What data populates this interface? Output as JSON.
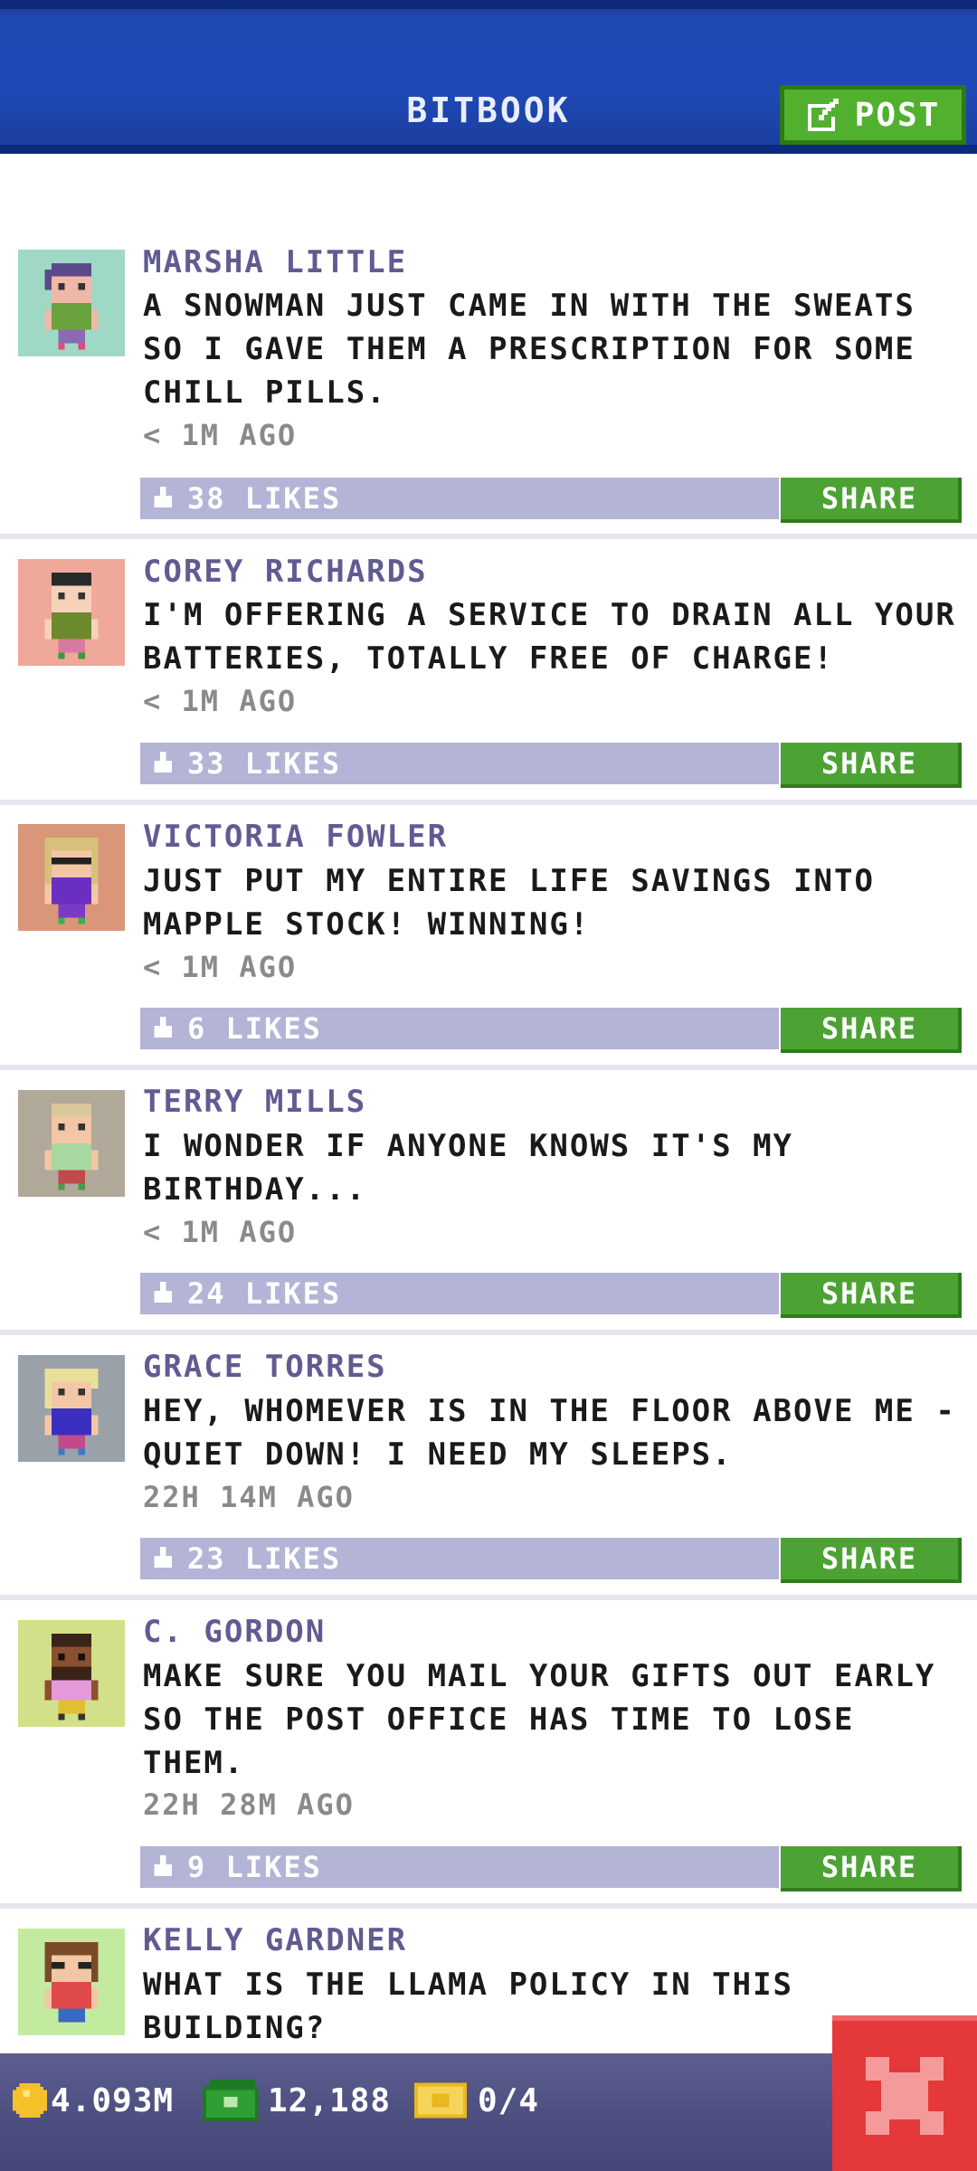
{
  "header": {
    "title": "BITBOOK",
    "post_label": "POST"
  },
  "posts": [
    {
      "author": "MARSHA LITTLE",
      "message": "A SNOWMAN JUST CAME IN WITH THE SWEATS SO I GAVE THEM A PRESCRIPTION FOR SOME CHILL PILLS.",
      "time": "< 1M AGO",
      "likes": "38 LIKES",
      "share_label": "SHARE",
      "avatar_bg": "#9fd9c6"
    },
    {
      "author": "COREY RICHARDS",
      "message": "I'M OFFERING A SERVICE TO DRAIN ALL YOUR BATTERIES, TOTALLY FREE OF CHARGE!",
      "time": "< 1M AGO",
      "likes": "33 LIKES",
      "share_label": "SHARE",
      "avatar_bg": "#f0a89a"
    },
    {
      "author": "VICTORIA FOWLER",
      "message": "JUST PUT MY ENTIRE LIFE SAVINGS INTO MAPPLE STOCK! WINNING!",
      "time": "< 1M AGO",
      "likes": "6 LIKES",
      "share_label": "SHARE",
      "avatar_bg": "#d99679"
    },
    {
      "author": "TERRY MILLS",
      "message": "I WONDER IF ANYONE KNOWS IT'S MY BIRTHDAY...",
      "time": "< 1M AGO",
      "likes": "24 LIKES",
      "share_label": "SHARE",
      "avatar_bg": "#b0a898"
    },
    {
      "author": "GRACE TORRES",
      "message": "HEY, WHOMEVER IS IN THE FLOOR ABOVE ME - QUIET DOWN! I NEED MY SLEEPS.",
      "time": "22H 14M AGO",
      "likes": "23 LIKES",
      "share_label": "SHARE",
      "avatar_bg": "#9aa1a8"
    },
    {
      "author": "C. GORDON",
      "message": "MAKE SURE YOU MAIL YOUR GIFTS OUT EARLY SO THE POST OFFICE HAS TIME TO LOSE THEM.",
      "time": "22H 28M AGO",
      "likes": "9 LIKES",
      "share_label": "SHARE",
      "avatar_bg": "#d3e08a"
    },
    {
      "author": "KELLY GARDNER",
      "message": "WHAT IS THE LLAMA POLICY IN THIS BUILDING?",
      "avatar_bg": "#c3eba0"
    }
  ],
  "status": {
    "coins": "4.093M",
    "bux": "12,188",
    "tickets": "0/4"
  },
  "colors": {
    "header_blue": "#2149b3",
    "share_green": "#4ca333",
    "likes_bar": "#b3b4d6",
    "author_purple": "#605c92",
    "close_red": "#e4383a"
  }
}
